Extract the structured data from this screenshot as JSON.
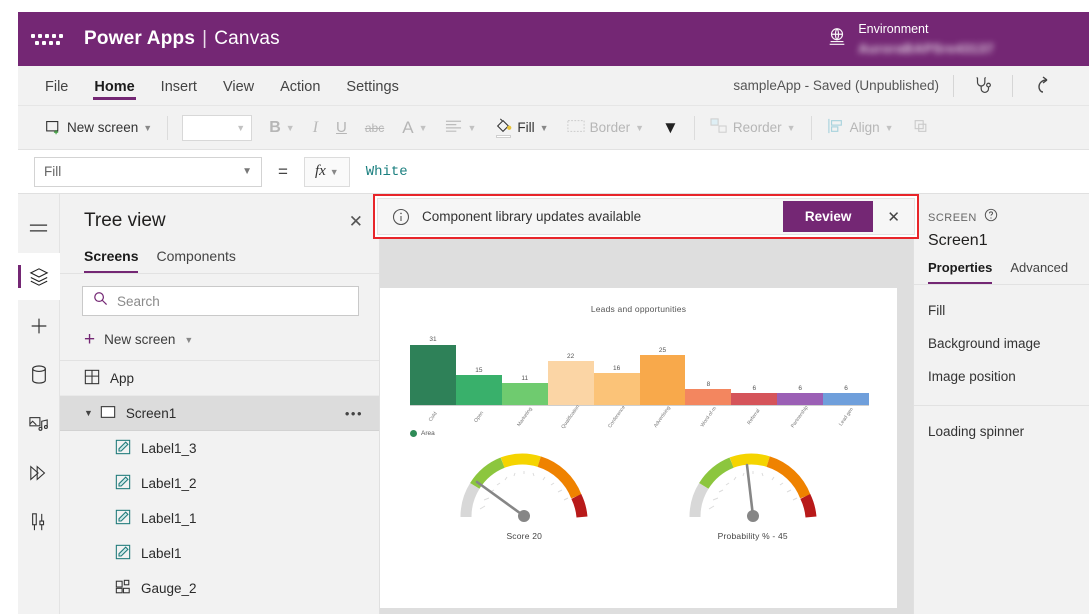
{
  "header": {
    "waffle_icon": "app-launcher-icon",
    "brand": "Power Apps",
    "separator": "|",
    "sub_brand": "Canvas",
    "globe_icon": "environment-globe-icon",
    "env_label": "Environment",
    "env_name": "AuroraBAPSre43137"
  },
  "menubar": {
    "items": [
      {
        "label": "File",
        "active": false
      },
      {
        "label": "Home",
        "active": true
      },
      {
        "label": "Insert",
        "active": false
      },
      {
        "label": "View",
        "active": false
      },
      {
        "label": "Action",
        "active": false
      },
      {
        "label": "Settings",
        "active": false
      }
    ],
    "app_state": "sampleApp - Saved (Unpublished)",
    "checker_icon": "app-checker-stethoscope-icon",
    "undo_icon": "undo-icon"
  },
  "ribbon": {
    "new_screen": "New screen",
    "font_placeholder": "",
    "bold": "B",
    "italic": "I",
    "underline": "U",
    "strikethrough": "abc",
    "font_color": "A",
    "align_icon": "text-align-icon",
    "fill_label": "Fill",
    "fill_icon": "paint-bucket-icon",
    "border_label": "Border",
    "border_icon": "border-icon",
    "more_icon": "chevron-down-icon",
    "reorder_label": "Reorder",
    "reorder_icon": "reorder-icon",
    "align_label": "Align",
    "align_group_icon": "align-icon",
    "group_icon": "group-icon"
  },
  "formula_bar": {
    "property": "Fill",
    "equals": "=",
    "fx": "fx",
    "value": "White"
  },
  "rail": {
    "items": [
      {
        "name": "hamburger-menu-icon",
        "active": false
      },
      {
        "name": "tree-view-layers-icon",
        "active": true
      },
      {
        "name": "insert-plus-icon",
        "active": false
      },
      {
        "name": "data-database-icon",
        "active": false
      },
      {
        "name": "media-icon",
        "active": false
      },
      {
        "name": "power-automate-flows-icon",
        "active": false
      },
      {
        "name": "variables-tools-icon",
        "active": false
      }
    ]
  },
  "tree_view": {
    "title": "Tree view",
    "close_icon": "close-icon",
    "tabs": [
      {
        "label": "Screens",
        "active": true
      },
      {
        "label": "Components",
        "active": false
      }
    ],
    "search_placeholder": "Search",
    "search_icon": "search-icon",
    "new_screen": "New screen",
    "items": [
      {
        "label": "App",
        "icon": "app-icon",
        "level": 0,
        "selected": false,
        "expandable": false
      },
      {
        "label": "Screen1",
        "icon": "screen-icon",
        "level": 0,
        "selected": true,
        "expandable": true,
        "overflow": "•••"
      },
      {
        "label": "Label1_3",
        "icon": "label-icon",
        "level": 1,
        "selected": false,
        "expandable": false
      },
      {
        "label": "Label1_2",
        "icon": "label-icon",
        "level": 1,
        "selected": false,
        "expandable": false
      },
      {
        "label": "Label1_1",
        "icon": "label-icon",
        "level": 1,
        "selected": false,
        "expandable": false
      },
      {
        "label": "Label1",
        "icon": "label-icon",
        "level": 1,
        "selected": false,
        "expandable": false
      },
      {
        "label": "Gauge_2",
        "icon": "component-icon",
        "level": 1,
        "selected": false,
        "expandable": false
      }
    ]
  },
  "banner": {
    "info_icon": "info-circle-icon",
    "message": "Component library updates available",
    "review_label": "Review",
    "close_icon": "close-icon",
    "highlight_color": "#e8252a",
    "button_color": "#742774"
  },
  "properties_panel": {
    "section_label": "SCREEN",
    "help_icon": "help-circle-icon",
    "screen_name": "Screen1",
    "tabs": [
      {
        "label": "Properties",
        "active": true
      },
      {
        "label": "Advanced",
        "active": false
      }
    ],
    "group1": [
      "Fill",
      "Background image",
      "Image position"
    ],
    "group2": [
      "Loading spinner"
    ]
  },
  "chart_data": [
    {
      "type": "bar",
      "title": "Leads and opportunities",
      "categories": [
        "Cold",
        "Open",
        "Marketing",
        "Qualification",
        "Conference",
        "Advertising",
        "Word-of-m",
        "Referral",
        "Partnership",
        "Lead gen"
      ],
      "values": [
        31,
        15,
        11,
        22,
        16,
        25,
        8,
        6,
        6,
        6
      ],
      "colors": [
        "#2e8b57",
        "#34b濾",
        "#6ecb6e",
        "#fad5a0",
        "#fbc276",
        "#f7a949",
        "#f1845e",
        "#d9534f",
        "#9b59b6",
        "#6f9fd8"
      ],
      "bar_colors": [
        "#2e8158",
        "#39b06b",
        "#6fcb6f",
        "#fbd5a5",
        "#fbc378",
        "#f8a94b",
        "#f3865f",
        "#d5545a",
        "#9b5fb5",
        "#6f9fdb"
      ],
      "legend": [
        "Area"
      ],
      "legend_position": "bottom-left",
      "legend_color": "#2e8b57",
      "ylabel": "",
      "xlabel": "",
      "grid": false,
      "ylim": [
        0,
        34
      ]
    },
    {
      "type": "gauge",
      "title": "Score",
      "caption": "Score    20",
      "value": 20,
      "min": 0,
      "max": 100,
      "needle_angle_deg": -126,
      "segments": [
        {
          "color": "#d8d8d8",
          "from": 0,
          "to": 12
        },
        {
          "color": "#8cc63e",
          "from": 12,
          "to": 34
        },
        {
          "color": "#f5d400",
          "from": 34,
          "to": 55
        },
        {
          "color": "#ef8200",
          "from": 55,
          "to": 80
        },
        {
          "color": "#b81a1a",
          "from": 80,
          "to": 100
        }
      ]
    },
    {
      "type": "gauge",
      "title": "Probability %",
      "caption": "Probability % -  45",
      "value": 45,
      "min": 0,
      "max": 100,
      "needle_angle_deg": -6,
      "segments": [
        {
          "color": "#d8d8d8",
          "from": 0,
          "to": 12
        },
        {
          "color": "#8cc63e",
          "from": 12,
          "to": 34
        },
        {
          "color": "#f5d400",
          "from": 34,
          "to": 55
        },
        {
          "color": "#ef8200",
          "from": 55,
          "to": 80
        },
        {
          "color": "#b81a1a",
          "from": 80,
          "to": 100
        }
      ]
    }
  ]
}
